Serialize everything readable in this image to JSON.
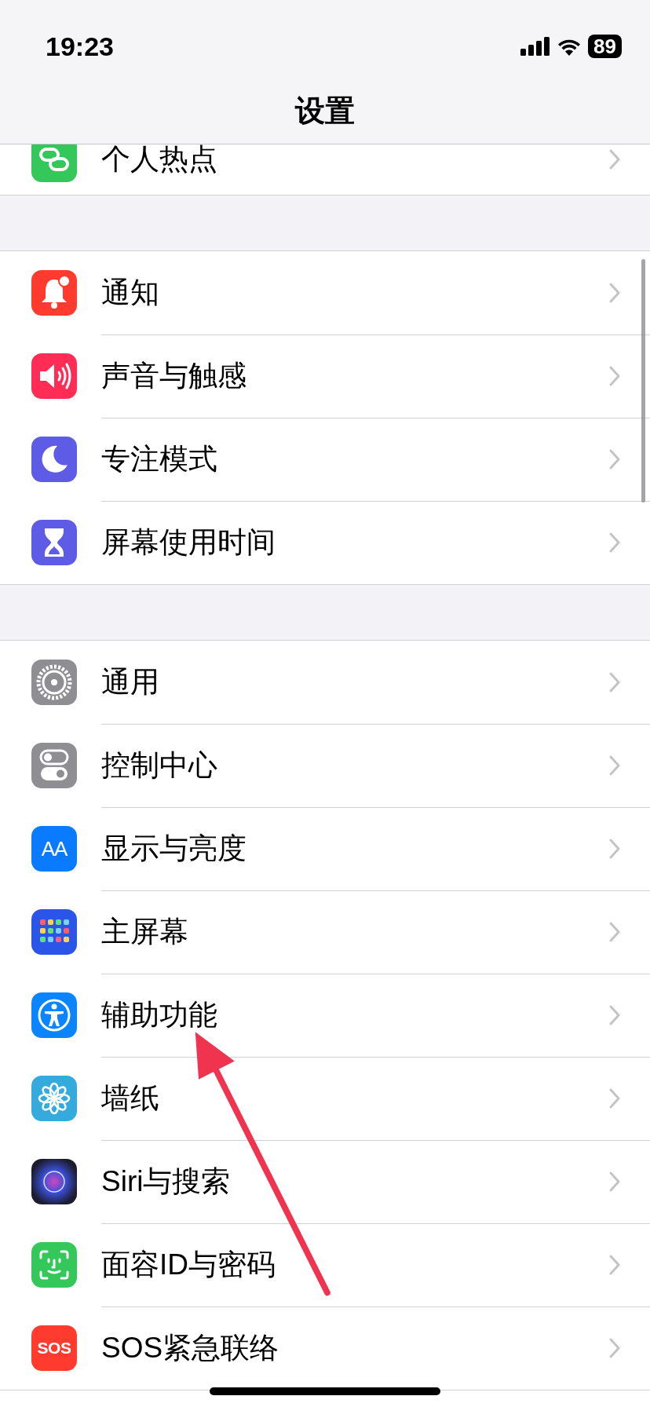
{
  "status_bar": {
    "time": "19:23",
    "battery": "89"
  },
  "nav": {
    "title": "设置"
  },
  "groups": [
    {
      "items": [
        {
          "label": "个人热点",
          "kind": "hotspot",
          "color": "#34c759"
        }
      ]
    },
    {
      "items": [
        {
          "label": "通知",
          "kind": "bell",
          "color": "#ff3b30"
        },
        {
          "label": "声音与触感",
          "kind": "speaker",
          "color": "#ff2d55"
        },
        {
          "label": "专注模式",
          "kind": "moon",
          "color": "#5e5ce6"
        },
        {
          "label": "屏幕使用时间",
          "kind": "hourglass",
          "color": "#5e5ce6"
        }
      ]
    },
    {
      "items": [
        {
          "label": "通用",
          "kind": "gear",
          "color": "#8e8e93"
        },
        {
          "label": "控制中心",
          "kind": "toggles",
          "color": "#8e8e93"
        },
        {
          "label": "显示与亮度",
          "kind": "glyph",
          "glyph": "AA",
          "color": "#0a7aff"
        },
        {
          "label": "主屏幕",
          "kind": "grid",
          "color": "#2b54e8"
        },
        {
          "label": "辅助功能",
          "kind": "person",
          "color": "#0a84ff"
        },
        {
          "label": "墙纸",
          "kind": "flower",
          "color": "#35aadc"
        },
        {
          "label": "Siri与搜索",
          "kind": "orb",
          "color": "#1c1c2e"
        },
        {
          "label": "面容ID与密码",
          "kind": "face",
          "color": "#34c759"
        },
        {
          "label": "SOS紧急联络",
          "kind": "glyph",
          "glyph": "SOS",
          "color": "#ff3b30"
        }
      ]
    }
  ],
  "annotation_arrow": true
}
